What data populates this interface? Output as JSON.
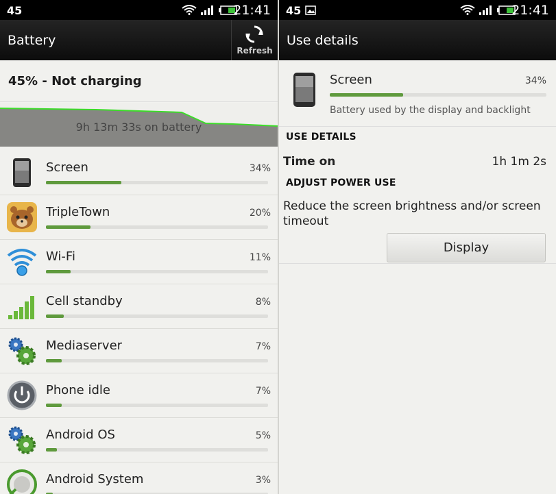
{
  "status_bar": {
    "notification_number": "45",
    "time": "21:41"
  },
  "left": {
    "title": "Battery",
    "refresh_label": "Refresh",
    "battery_status": "45% - Not charging",
    "graph_caption": "9h 13m 33s on battery",
    "usage": [
      {
        "name": "Screen",
        "percent": "34%",
        "value": 34,
        "icon": "phone-icon"
      },
      {
        "name": "TripleTown",
        "percent": "20%",
        "value": 20,
        "icon": "tripletown-app-icon"
      },
      {
        "name": "Wi-Fi",
        "percent": "11%",
        "value": 11,
        "icon": "wifi-icon"
      },
      {
        "name": "Cell standby",
        "percent": "8%",
        "value": 8,
        "icon": "cell-signal-icon"
      },
      {
        "name": "Mediaserver",
        "percent": "7%",
        "value": 7,
        "icon": "gears-icon"
      },
      {
        "name": "Phone idle",
        "percent": "7%",
        "value": 7,
        "icon": "power-icon"
      },
      {
        "name": "Android OS",
        "percent": "5%",
        "value": 5,
        "icon": "gears-icon"
      },
      {
        "name": "Android System",
        "percent": "3%",
        "value": 3,
        "icon": "android-system-icon"
      }
    ]
  },
  "right": {
    "title": "Use details",
    "item_name": "Screen",
    "item_percent": "34%",
    "item_value": 34,
    "item_description": "Battery used by the display and backlight",
    "use_details_heading": "USE DETAILS",
    "time_on_label": "Time on",
    "time_on_value": "1h 1m 2s",
    "adjust_heading": "ADJUST POWER USE",
    "adjust_text": "Reduce the screen brightness and/or screen timeout",
    "display_button": "Display"
  },
  "colors": {
    "bar_fill": "#5f9a3d",
    "graph_line": "#3ddc2a",
    "battery_green": "#3ec13a"
  }
}
